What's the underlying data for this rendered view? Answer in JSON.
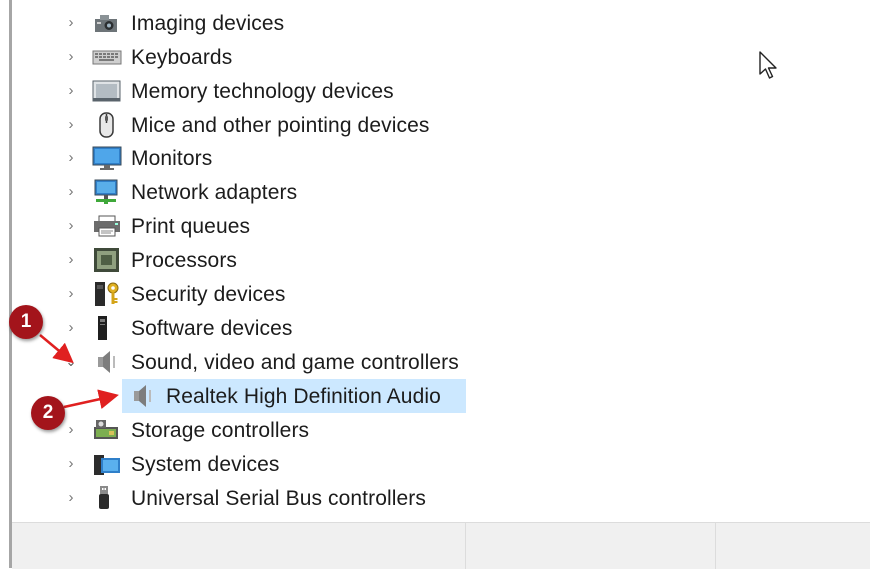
{
  "tree": {
    "items": [
      {
        "label": "Imaging devices",
        "icon": "camera-icon",
        "expanded": false
      },
      {
        "label": "Keyboards",
        "icon": "keyboard-icon",
        "expanded": false
      },
      {
        "label": "Memory technology devices",
        "icon": "memory-icon",
        "expanded": false
      },
      {
        "label": "Mice and other pointing devices",
        "icon": "mouse-icon",
        "expanded": false
      },
      {
        "label": "Monitors",
        "icon": "monitor-icon",
        "expanded": false
      },
      {
        "label": "Network adapters",
        "icon": "network-icon",
        "expanded": false
      },
      {
        "label": "Print queues",
        "icon": "printer-icon",
        "expanded": false
      },
      {
        "label": "Processors",
        "icon": "processor-icon",
        "expanded": false
      },
      {
        "label": "Security devices",
        "icon": "security-key-icon",
        "expanded": false
      },
      {
        "label": "Software devices",
        "icon": "software-device-icon",
        "expanded": false
      },
      {
        "label": "Sound, video and game controllers",
        "icon": "speaker-icon",
        "expanded": true
      },
      {
        "label": "Storage controllers",
        "icon": "storage-icon",
        "expanded": false
      },
      {
        "label": "System devices",
        "icon": "system-folder-icon",
        "expanded": false
      },
      {
        "label": "Universal Serial Bus controllers",
        "icon": "usb-icon",
        "expanded": false
      }
    ],
    "child": {
      "label": "Realtek High Definition Audio",
      "icon": "speaker-icon",
      "selected": true
    }
  },
  "annotations": {
    "step1": "1",
    "step2": "2"
  },
  "colors": {
    "selection": "#cce8ff",
    "annotation": "#a3141b",
    "arrow": "#e02020"
  }
}
